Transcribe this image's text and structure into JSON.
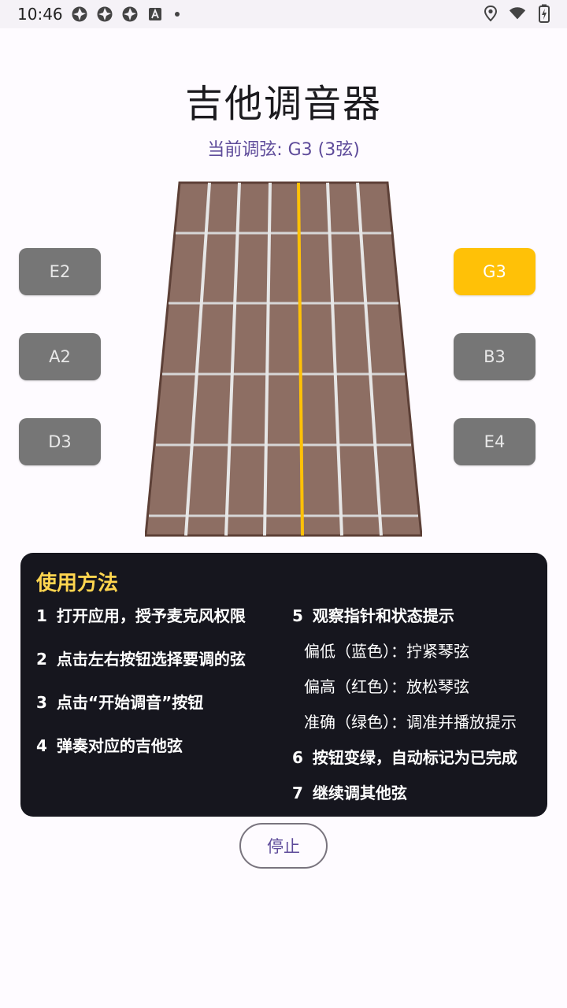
{
  "status_bar": {
    "time": "10:46",
    "left_icons": [
      "aperture-icon",
      "aperture-icon",
      "aperture-icon",
      "a-box-icon",
      "dot-icon"
    ],
    "right_icons": [
      "location-icon",
      "wifi-icon",
      "battery-charging-icon"
    ]
  },
  "title": "吉他调音器",
  "current_string": "当前调弦: G3 (3弦)",
  "strings_left": [
    {
      "label": "E2",
      "active": false
    },
    {
      "label": "A2",
      "active": false
    },
    {
      "label": "D3",
      "active": false
    }
  ],
  "strings_right": [
    {
      "label": "G3",
      "active": true
    },
    {
      "label": "B3",
      "active": false
    },
    {
      "label": "E4",
      "active": false
    }
  ],
  "colors": {
    "accent": "#ffc107",
    "button_inactive": "#767676",
    "fretboard_wood": "#8d6e63",
    "fretboard_border": "#5d4037",
    "panel_bg": "#16161e",
    "panel_title": "#ffd54f",
    "subtitle": "#5e4b9a"
  },
  "help": {
    "title": "使用方法",
    "left": [
      {
        "num": "1",
        "text": "打开应用，授予麦克风权限"
      },
      {
        "num": "2",
        "text": "点击左右按钮选择要调的弦"
      },
      {
        "num": "3",
        "text": "点击“开始调音”按钮"
      },
      {
        "num": "4",
        "text": "弹奏对应的吉他弦"
      }
    ],
    "right": [
      {
        "num": "5",
        "text": "观察指针和状态提示"
      },
      {
        "num": "",
        "text": "偏低（蓝色）：拧紧琴弦"
      },
      {
        "num": "",
        "text": "偏高（红色）：放松琴弦"
      },
      {
        "num": "",
        "text": "准确（绿色）：调准并播放提示"
      },
      {
        "num": "6",
        "text": "按钮变绿，自动标记为已完成"
      },
      {
        "num": "7",
        "text": "继续调其他弦"
      }
    ]
  },
  "stop_button": "停止"
}
